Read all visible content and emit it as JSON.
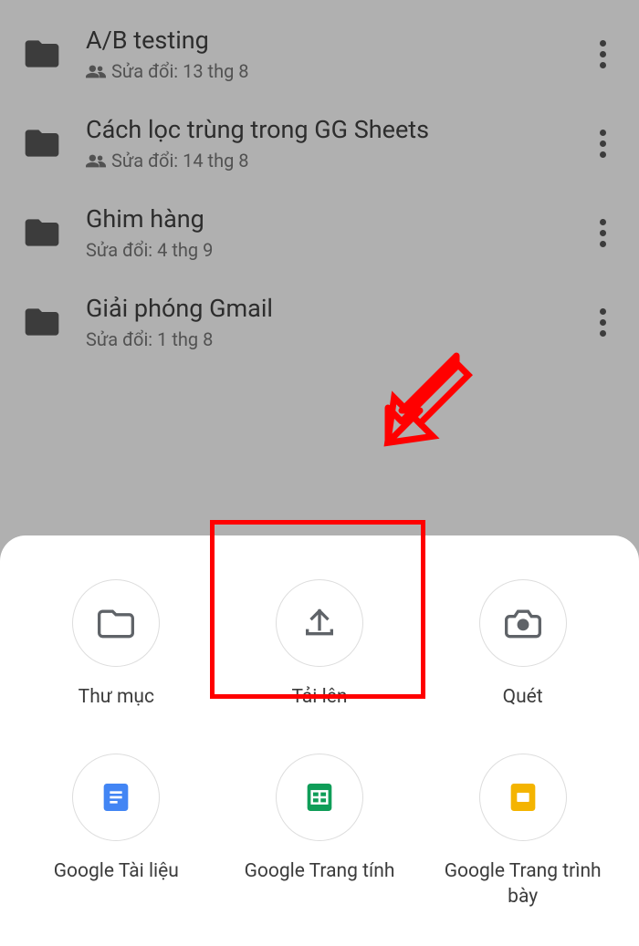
{
  "files": [
    {
      "name": "A/B testing",
      "meta": "Sửa đổi: 13 thg 8",
      "shared": true
    },
    {
      "name": "Cách lọc trùng trong GG Sheets",
      "meta": "Sửa đổi: 14 thg 8",
      "shared": true
    },
    {
      "name": "Ghim hàng",
      "meta": "Sửa đổi: 4 thg 9",
      "shared": false
    },
    {
      "name": "Giải phóng Gmail",
      "meta": "Sửa đổi: 1 thg 8",
      "shared": false
    }
  ],
  "sheet": [
    {
      "label": "Thư mục",
      "icon": "folder-outline"
    },
    {
      "label": "Tải lên",
      "icon": "upload"
    },
    {
      "label": "Quét",
      "icon": "camera"
    },
    {
      "label": "Google Tài liệu",
      "icon": "docs"
    },
    {
      "label": "Google Trang tính",
      "icon": "sheets"
    },
    {
      "label": "Google Trang trình bày",
      "icon": "slides"
    }
  ]
}
